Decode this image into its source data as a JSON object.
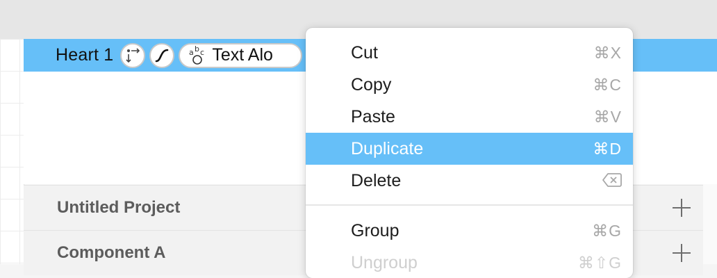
{
  "layer": {
    "name": "Heart 1",
    "chips": {
      "rotate_icon": "arrows-rotate-icon",
      "curve_icon": "curve-icon",
      "text_along_icon": "text-along-path-icon",
      "text_along_label": "Text Alo"
    }
  },
  "sections": [
    {
      "title": "Untitled Project",
      "add_icon": "plus-icon"
    },
    {
      "title": "Component A",
      "add_icon": "plus-icon"
    }
  ],
  "context_menu": {
    "items": [
      {
        "label": "Cut",
        "shortcut": "⌘X"
      },
      {
        "label": "Copy",
        "shortcut": "⌘C"
      },
      {
        "label": "Paste",
        "shortcut": "⌘V"
      },
      {
        "label": "Duplicate",
        "shortcut": "⌘D",
        "highlighted": true
      },
      {
        "label": "Delete",
        "shortcut_icon": "delete-key-icon"
      },
      {
        "label": "Group",
        "shortcut": "⌘G"
      },
      {
        "label": "Ungroup",
        "shortcut": "⌘⇧G",
        "disabled": true
      }
    ]
  },
  "colors": {
    "selection": "#66bff8",
    "menu_bg": "#ffffff",
    "shortcut_text": "#a7a7a7"
  }
}
